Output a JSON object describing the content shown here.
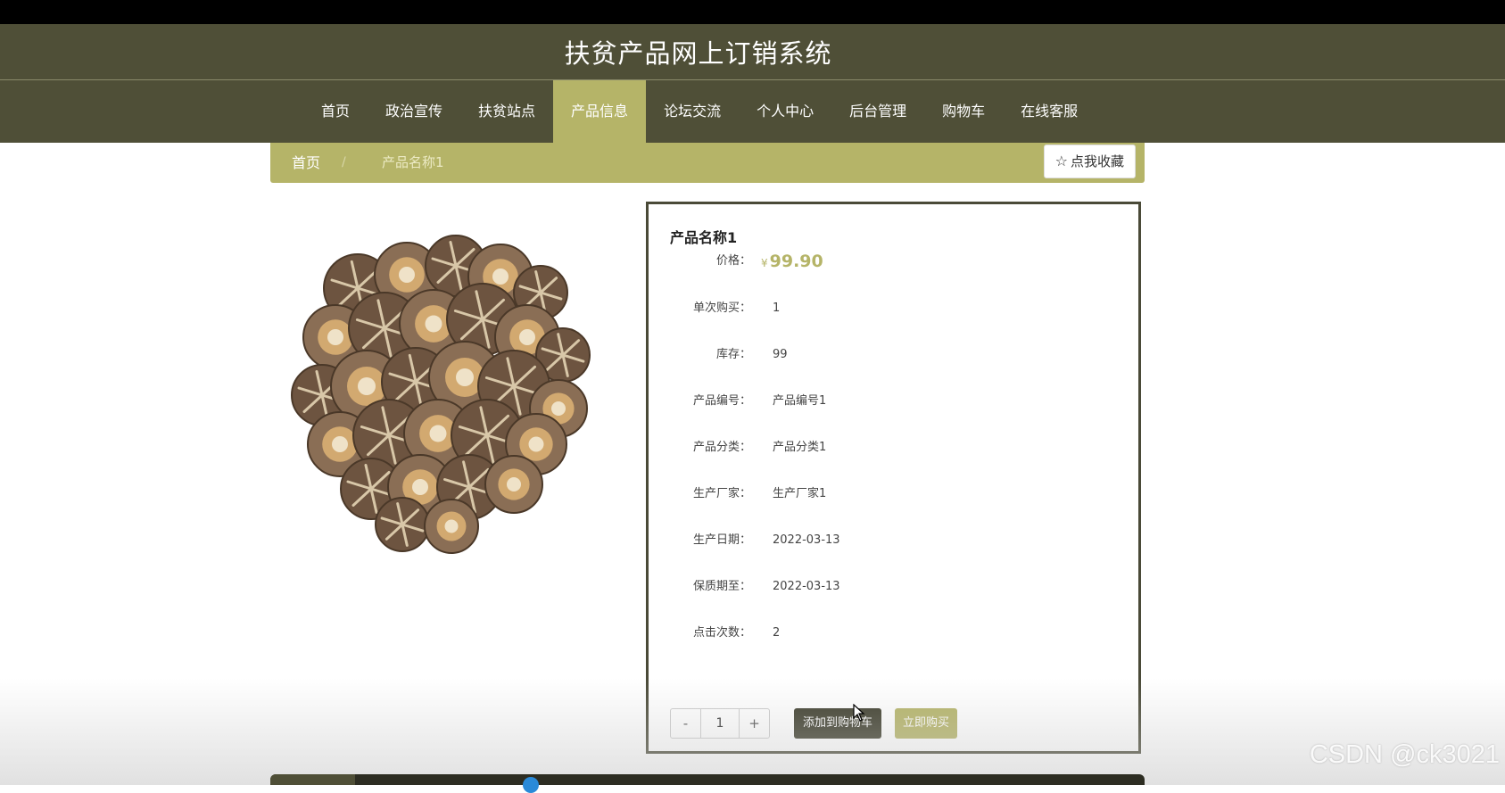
{
  "site": {
    "title": "扶贫产品网上订销系统"
  },
  "nav": {
    "items": [
      {
        "label": "首页"
      },
      {
        "label": "政治宣传"
      },
      {
        "label": "扶贫站点"
      },
      {
        "label": "产品信息",
        "active": true
      },
      {
        "label": "论坛交流"
      },
      {
        "label": "个人中心"
      },
      {
        "label": "后台管理"
      },
      {
        "label": "购物车"
      },
      {
        "label": "在线客服"
      }
    ]
  },
  "breadcrumb": {
    "home": "首页",
    "separator": "/",
    "current": "产品名称1"
  },
  "collect_button": {
    "icon": "star-outline-icon",
    "label": "点我收藏"
  },
  "product": {
    "image_icon": "shiitake-mushroom-image",
    "name": "产品名称1",
    "price_label": "价格：",
    "currency": "¥",
    "price": "99.90",
    "fields": [
      {
        "label": "单次购买：",
        "value": "1"
      },
      {
        "label": "库存：",
        "value": "99"
      },
      {
        "label": "产品编号：",
        "value": "产品编号1"
      },
      {
        "label": "产品分类：",
        "value": "产品分类1"
      },
      {
        "label": "生产厂家：",
        "value": "生产厂家1"
      },
      {
        "label": "生产日期：",
        "value": "2022-03-13"
      },
      {
        "label": "保质期至：",
        "value": "2022-03-13"
      },
      {
        "label": "点击次数：",
        "value": "2"
      }
    ]
  },
  "quantity": {
    "minus": "-",
    "value": "1",
    "plus": "+"
  },
  "actions": {
    "add_to_cart": "添加到购物车",
    "buy_now": "立即购买"
  },
  "watermark": "CSDN @ck3021",
  "colors": {
    "header": "#4f4f37",
    "accent": "#b5b468",
    "dark_button": "#3d3d2c"
  }
}
